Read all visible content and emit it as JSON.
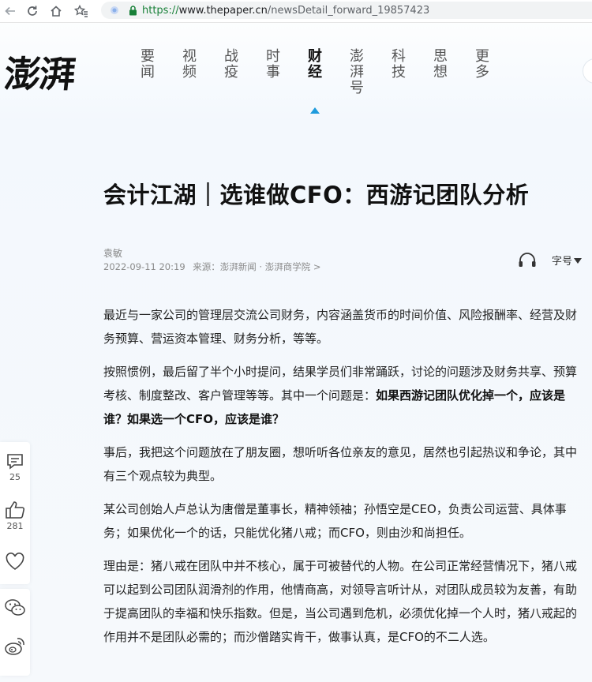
{
  "browser": {
    "url_scheme": "https://",
    "url_host": "www.thepaper.cn",
    "url_path": "/newsDetail_forward_19857423"
  },
  "site": {
    "logo_text": "澎湃",
    "nav": [
      {
        "label": "要闻",
        "active": false
      },
      {
        "label": "视频",
        "active": false
      },
      {
        "label": "战疫",
        "active": false
      },
      {
        "label": "时事",
        "active": false
      },
      {
        "label": "财经",
        "active": true
      },
      {
        "label": "澎湃号",
        "active": false
      },
      {
        "label": "科技",
        "active": false
      },
      {
        "label": "思想",
        "active": false
      },
      {
        "label": "更多",
        "active": false
      }
    ],
    "accent_color": "#1f9bdc"
  },
  "article": {
    "title": "会计江湖｜选谁做CFO：西游记团队分析",
    "author": "袁敏",
    "date": "2022-09-11 20:19",
    "source": "来源：澎湃新闻 · 澎湃商学院 >",
    "font_size_label": "字号",
    "paragraphs": {
      "p1": "最近与一家公司的管理层交流公司财务，内容涵盖货币的时间价值、风险报酬率、经营及财务预算、营运资本管理、财务分析，等等。",
      "p2_plain": "按照惯例，最后留了半个小时提问，结果学员们非常踊跃，讨论的问题涉及财务共享、预算考核、制度整改、客户管理等等。其中一个问题是：",
      "p2_bold": "如果西游记团队优化掉一个，应该是谁？如果选一个CFO，应该是谁？",
      "p3": "事后，我把这个问题放在了朋友圈，想听听各位亲友的意见，居然也引起热议和争论，其中有三个观点较为典型。",
      "p4": "某公司创始人卢总认为唐僧是董事长，精神领袖；孙悟空是CEO，负责公司运营、具体事务；如果优化一个的话，只能优化猪八戒；而CFO，则由沙和尚担任。",
      "p5": "理由是：猪八戒在团队中并不核心，属于可被替代的人物。在公司正常经营情况下，猪八戒可以起到公司团队润滑剂的作用，他情商高，对领导言听计从，对团队成员较为友善，有助于提高团队的幸福和快乐指数。但是，当公司遇到危机，必须优化掉一个人时，猪八戒起的作用并不是团队必需的；而沙僧踏实肯干，做事认真，是CFO的不二人选。"
    }
  },
  "share": {
    "comments": "25",
    "likes": "281"
  }
}
